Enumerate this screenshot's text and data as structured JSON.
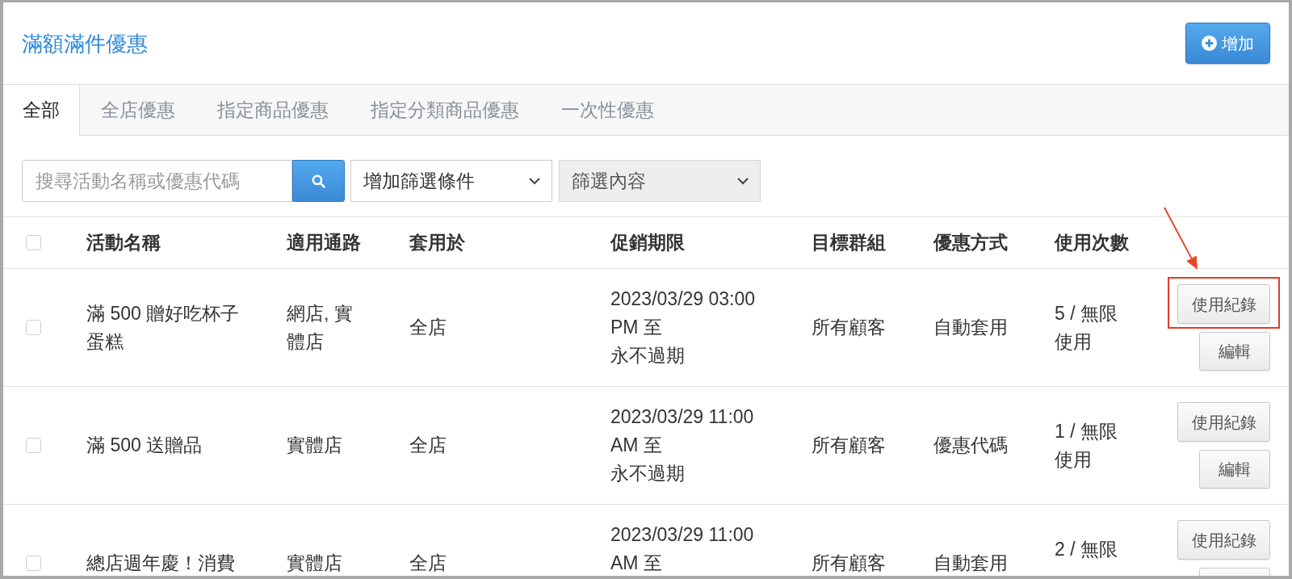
{
  "header": {
    "title": "滿額滿件優惠",
    "add_button": "增加"
  },
  "tabs": [
    {
      "label": "全部",
      "selected": true
    },
    {
      "label": "全店優惠",
      "selected": false
    },
    {
      "label": "指定商品優惠",
      "selected": false
    },
    {
      "label": "指定分類商品優惠",
      "selected": false
    },
    {
      "label": "一次性優惠",
      "selected": false
    }
  ],
  "filters": {
    "search": {
      "placeholder": "搜尋活動名稱或優惠代碼"
    },
    "dropdowns": [
      {
        "value": "增加篩選條件",
        "disabled": false
      },
      {
        "value": "篩選內容",
        "disabled": true
      }
    ]
  },
  "table": {
    "select_all": {
      "checked": false
    },
    "columns": [
      "活動名稱",
      "適用通路",
      "套用於",
      "促銷期限",
      "目標群組",
      "優惠方式",
      "使用次數"
    ],
    "rows": [
      {
        "checked": false,
        "name": "滿 500 贈好吃杯子蛋糕",
        "channel": "網店, 實體店",
        "applies_to": "全店",
        "period": {
          "start": "2023/03/29 03:00 PM 至",
          "end": "永不過期"
        },
        "target": "所有顧客",
        "method": "自動套用",
        "usage": "5 / 無限使用",
        "actions": [
          {
            "kind": "record",
            "label": "使用紀錄",
            "highlighted": true
          },
          {
            "kind": "edit",
            "label": "編輯",
            "highlighted": false
          }
        ]
      },
      {
        "checked": false,
        "name": "滿 500 送贈品",
        "channel": "實體店",
        "applies_to": "全店",
        "period": {
          "start": "2023/03/29 11:00 AM 至",
          "end": "永不過期"
        },
        "target": "所有顧客",
        "method": "優惠代碼",
        "usage": "1 / 無限使用",
        "actions": [
          {
            "kind": "record",
            "label": "使用紀錄",
            "highlighted": false
          },
          {
            "kind": "edit",
            "label": "編輯",
            "highlighted": false
          }
        ]
      },
      {
        "checked": false,
        "name": "總店週年慶！消費",
        "channel": "實體店",
        "applies_to": "全店",
        "period": {
          "start": "2023/03/29 11:00 AM 至"
        },
        "target": "所有顧客",
        "method": "自動套用",
        "usage": "2 / 無限",
        "actions": [
          {
            "kind": "record",
            "label": "使用紀錄",
            "highlighted": false
          },
          {
            "kind": "edit",
            "highlighted": false
          }
        ]
      }
    ]
  }
}
